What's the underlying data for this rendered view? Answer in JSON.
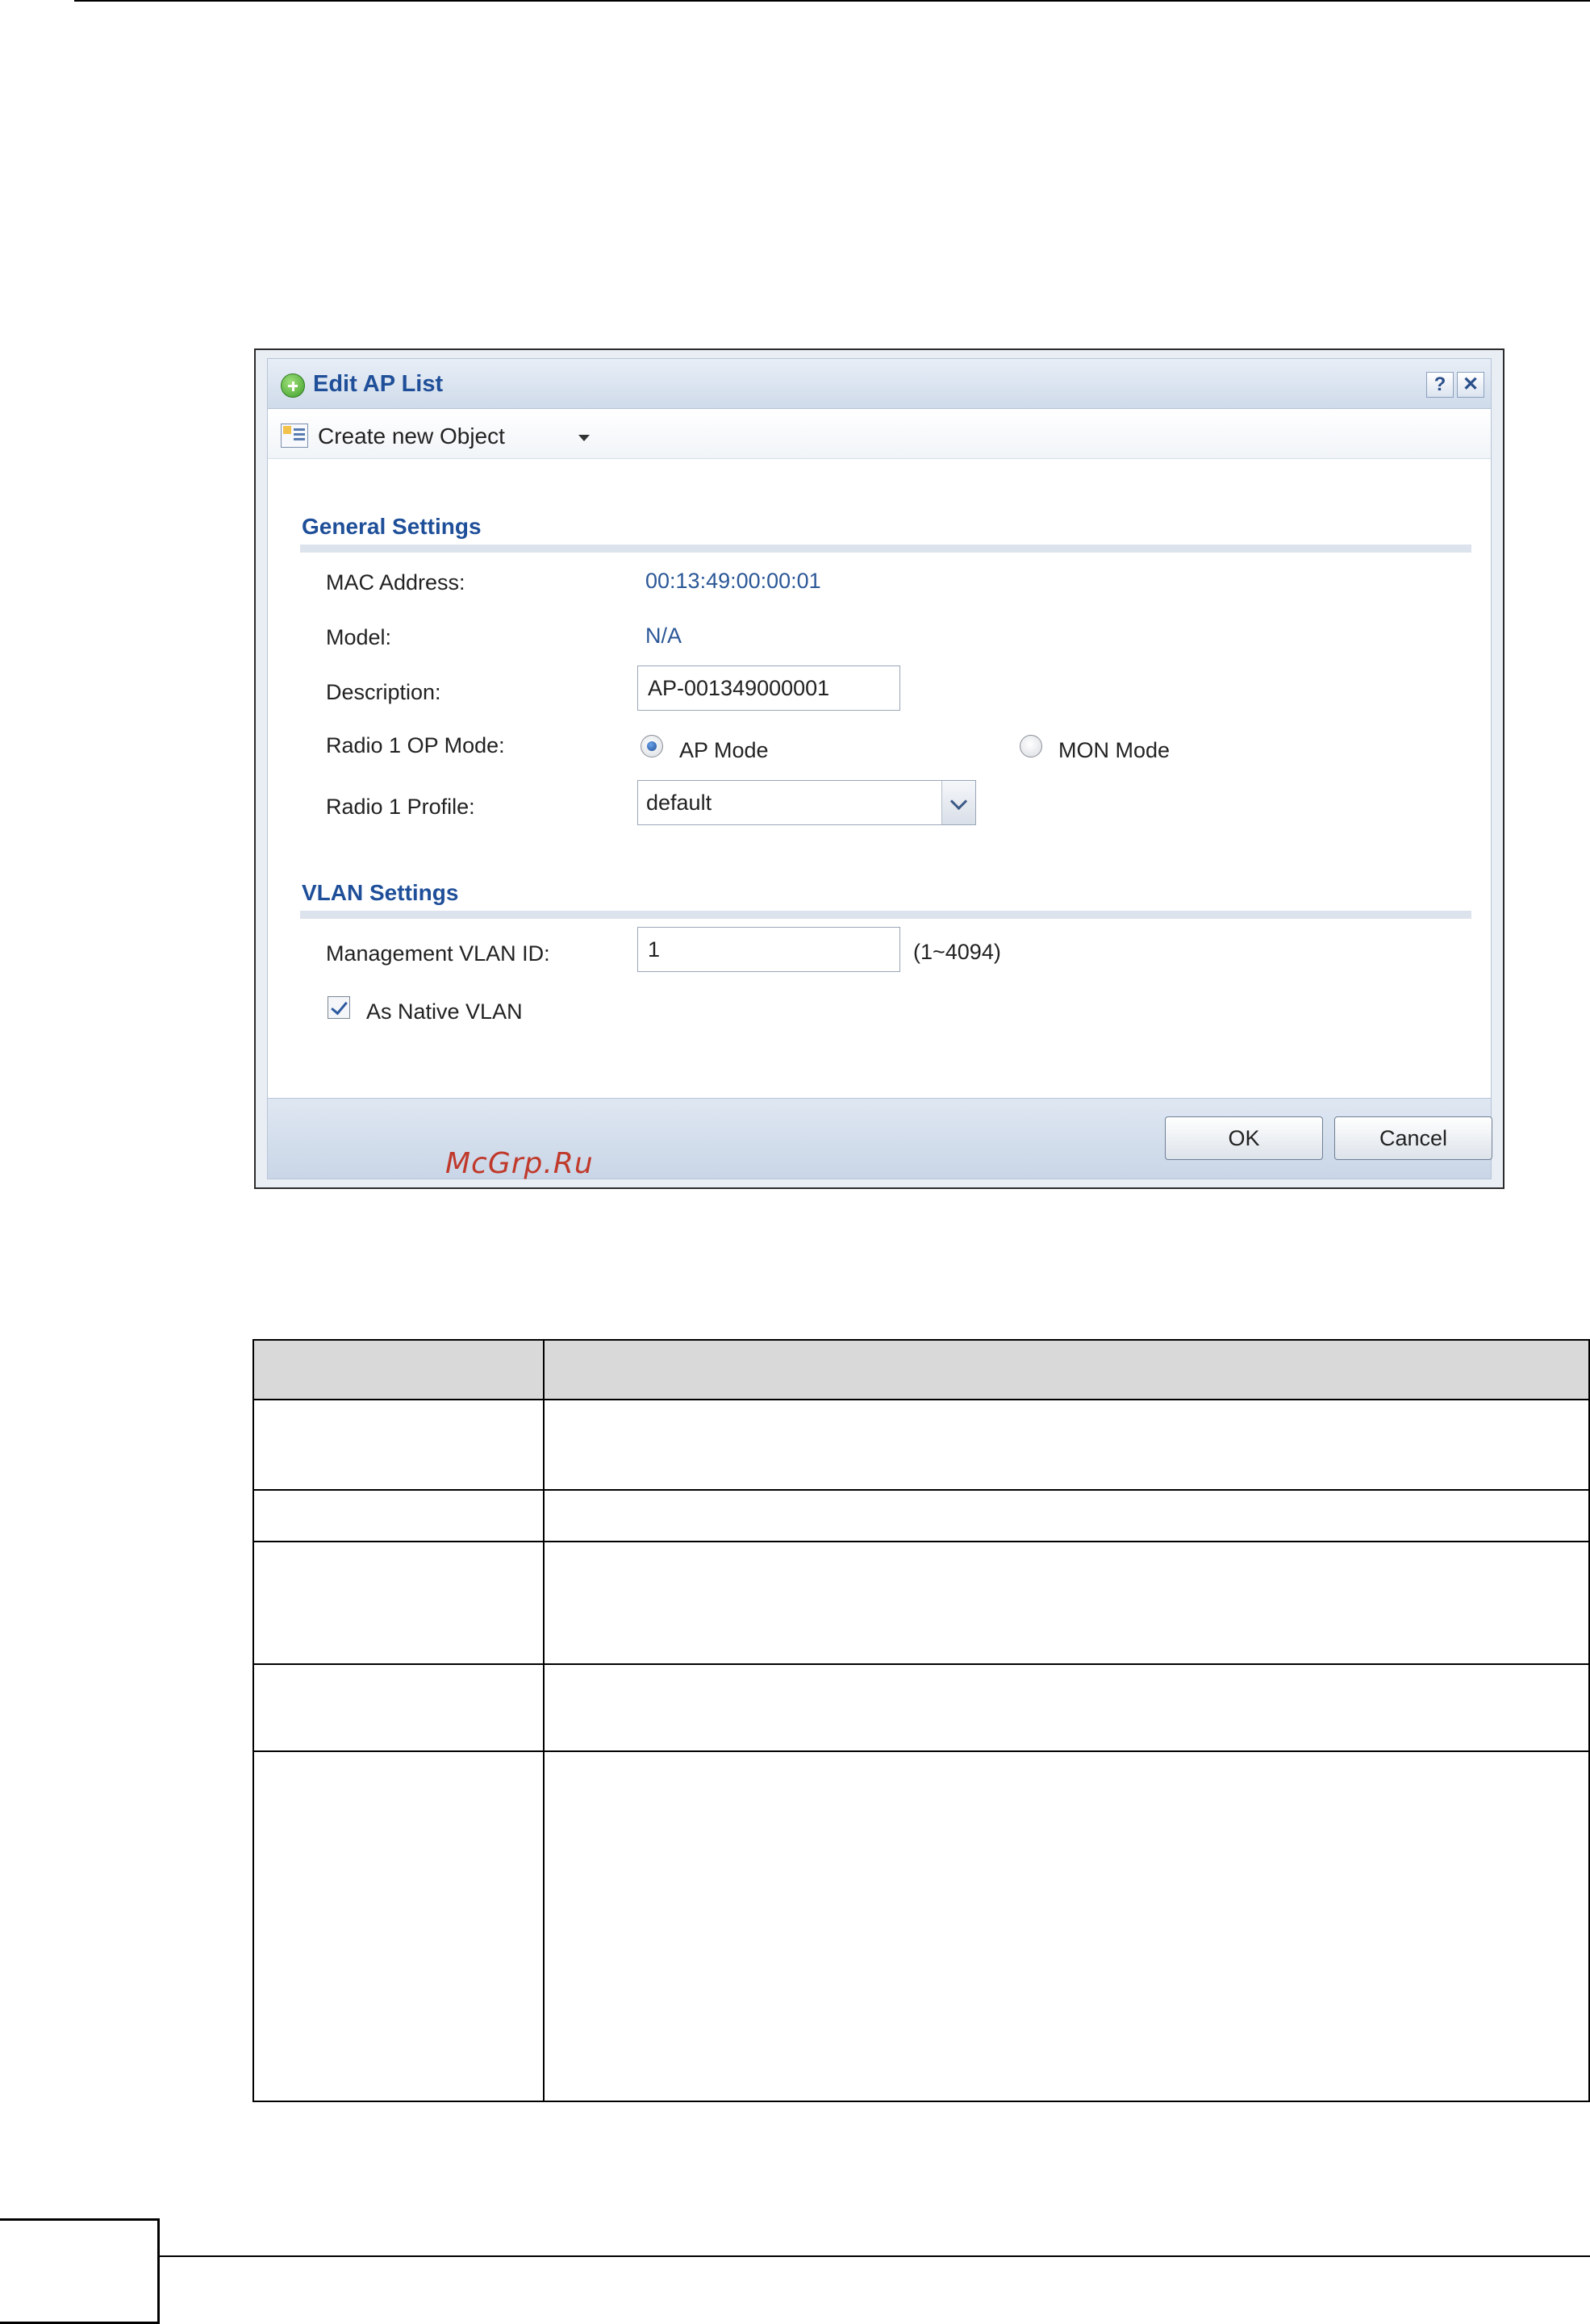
{
  "dialog": {
    "title": "Edit AP List",
    "help_label": "?",
    "close_label": "✕",
    "toolbar": {
      "create_label": "Create new Object"
    },
    "general": {
      "heading": "General Settings",
      "mac_label": "MAC Address:",
      "mac_value": "00:13:49:00:00:01",
      "model_label": "Model:",
      "model_value": "N/A",
      "description_label": "Description:",
      "description_value": "AP-001349000001",
      "op_mode_label": "Radio 1 OP Mode:",
      "op_mode_options": [
        "AP Mode",
        "MON Mode"
      ],
      "op_mode_selected": "AP Mode",
      "profile_label": "Radio 1 Profile:",
      "profile_value": "default"
    },
    "vlan": {
      "heading": "VLAN Settings",
      "vlan_id_label": "Management VLAN ID:",
      "vlan_id_value": "1",
      "vlan_id_range": "(1~4094)",
      "native_label": "As Native VLAN",
      "native_checked": true
    },
    "buttons": {
      "ok": "OK",
      "cancel": "Cancel"
    },
    "watermark": "McGrp.Ru"
  },
  "icons": [
    "add-circle-icon",
    "create-object-icon",
    "caret-down-icon",
    "help-icon",
    "close-icon",
    "chevron-down-icon",
    "checkmark-icon"
  ]
}
